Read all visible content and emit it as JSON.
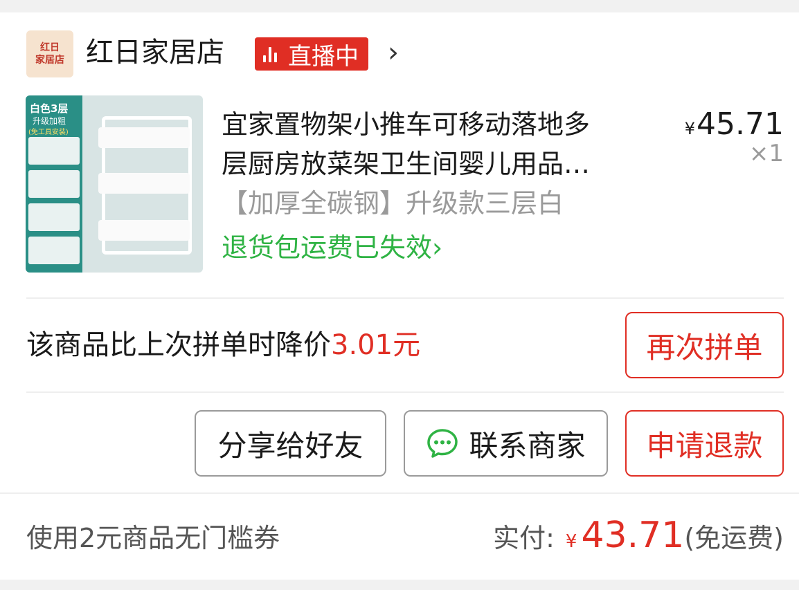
{
  "store": {
    "logo_line1": "红日",
    "logo_line2": "家居店",
    "name": "红日家居店",
    "live_label": "直播中",
    "chevron": "›"
  },
  "product": {
    "title": "宜家置物架小推车可移动落地多层厨房放菜架卫生间婴儿用品…",
    "title_line1": "宜家置物架小推车可移动落地多",
    "title_line2": "层厨房放菜架卫生间婴儿用品…",
    "price_symbol": "¥",
    "price": "45.71",
    "quantity": "×1",
    "spec": "【加厚全碳钢】升级款三层白",
    "return_status": "退货包运费已失效",
    "return_chevron": "›",
    "thumb_text": {
      "color_label": "白色3层",
      "upgrade_label": "升级加粗",
      "install_label": "(免工具安装)"
    }
  },
  "price_drop": {
    "text": "该商品比上次拼单时降价",
    "amount": "3.01元"
  },
  "buttons": {
    "reorder": "再次拼单",
    "share": "分享给好友",
    "contact": "联系商家",
    "refund": "申请退款"
  },
  "footer": {
    "coupon": "使用2元商品无门槛券",
    "paid_label": "实付:",
    "paid_symbol": "¥",
    "paid_amount": "43.71",
    "shipping_note": "(免运费)"
  },
  "colors": {
    "accent_red": "#e02e24",
    "green": "#2fb344",
    "muted": "#9a9a9a"
  }
}
